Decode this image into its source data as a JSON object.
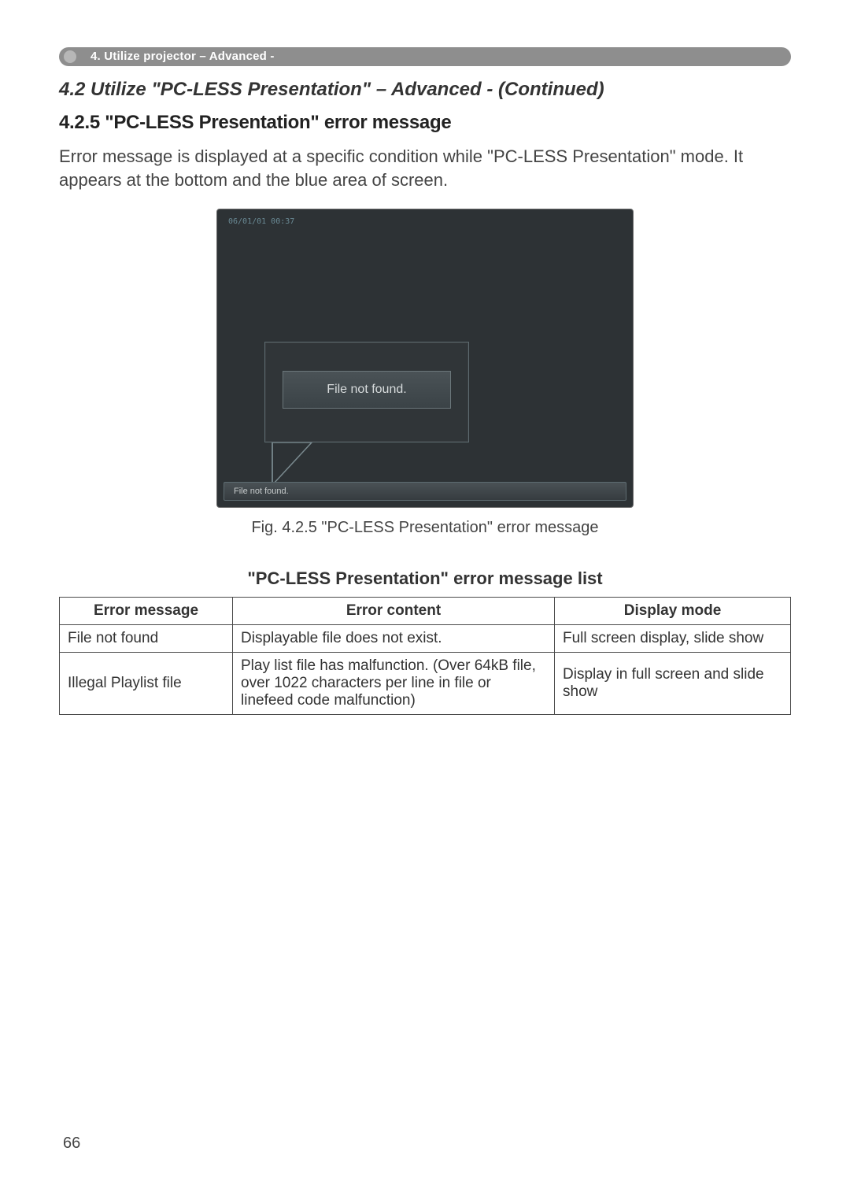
{
  "ribbon": {
    "label": "4. Utilize projector – Advanced -"
  },
  "section": {
    "title": "4.2 Utilize \"PC-LESS Presentation\" – Advanced - (Continued)"
  },
  "subsection": {
    "title": "4.2.5 \"PC-LESS Presentation\" error message"
  },
  "intro": "Error message is displayed at a specific condition while \"PC-LESS Presentation\" mode. It appears at the bottom and the blue area of screen.",
  "screenshot": {
    "timestamp": "06/01/01 00:37",
    "popup_text": "File not found.",
    "statusbar_text": "File not found."
  },
  "caption": "Fig. 4.2.5 \"PC-LESS Presentation\" error message",
  "table_title": "\"PC-LESS Presentation\" error message list",
  "table": {
    "headers": {
      "c1": "Error message",
      "c2": "Error content",
      "c3": "Display mode"
    },
    "rows": [
      {
        "c1": "File not found",
        "c2": "Displayable file does not exist.",
        "c3": "Full screen display, slide show"
      },
      {
        "c1": "Illegal Playlist file",
        "c2": "Play list file has malfunction. (Over 64kB file, over 1022 characters per line in file or linefeed code malfunction)",
        "c3": "Display in full screen and slide show"
      }
    ]
  },
  "page_number": "66"
}
